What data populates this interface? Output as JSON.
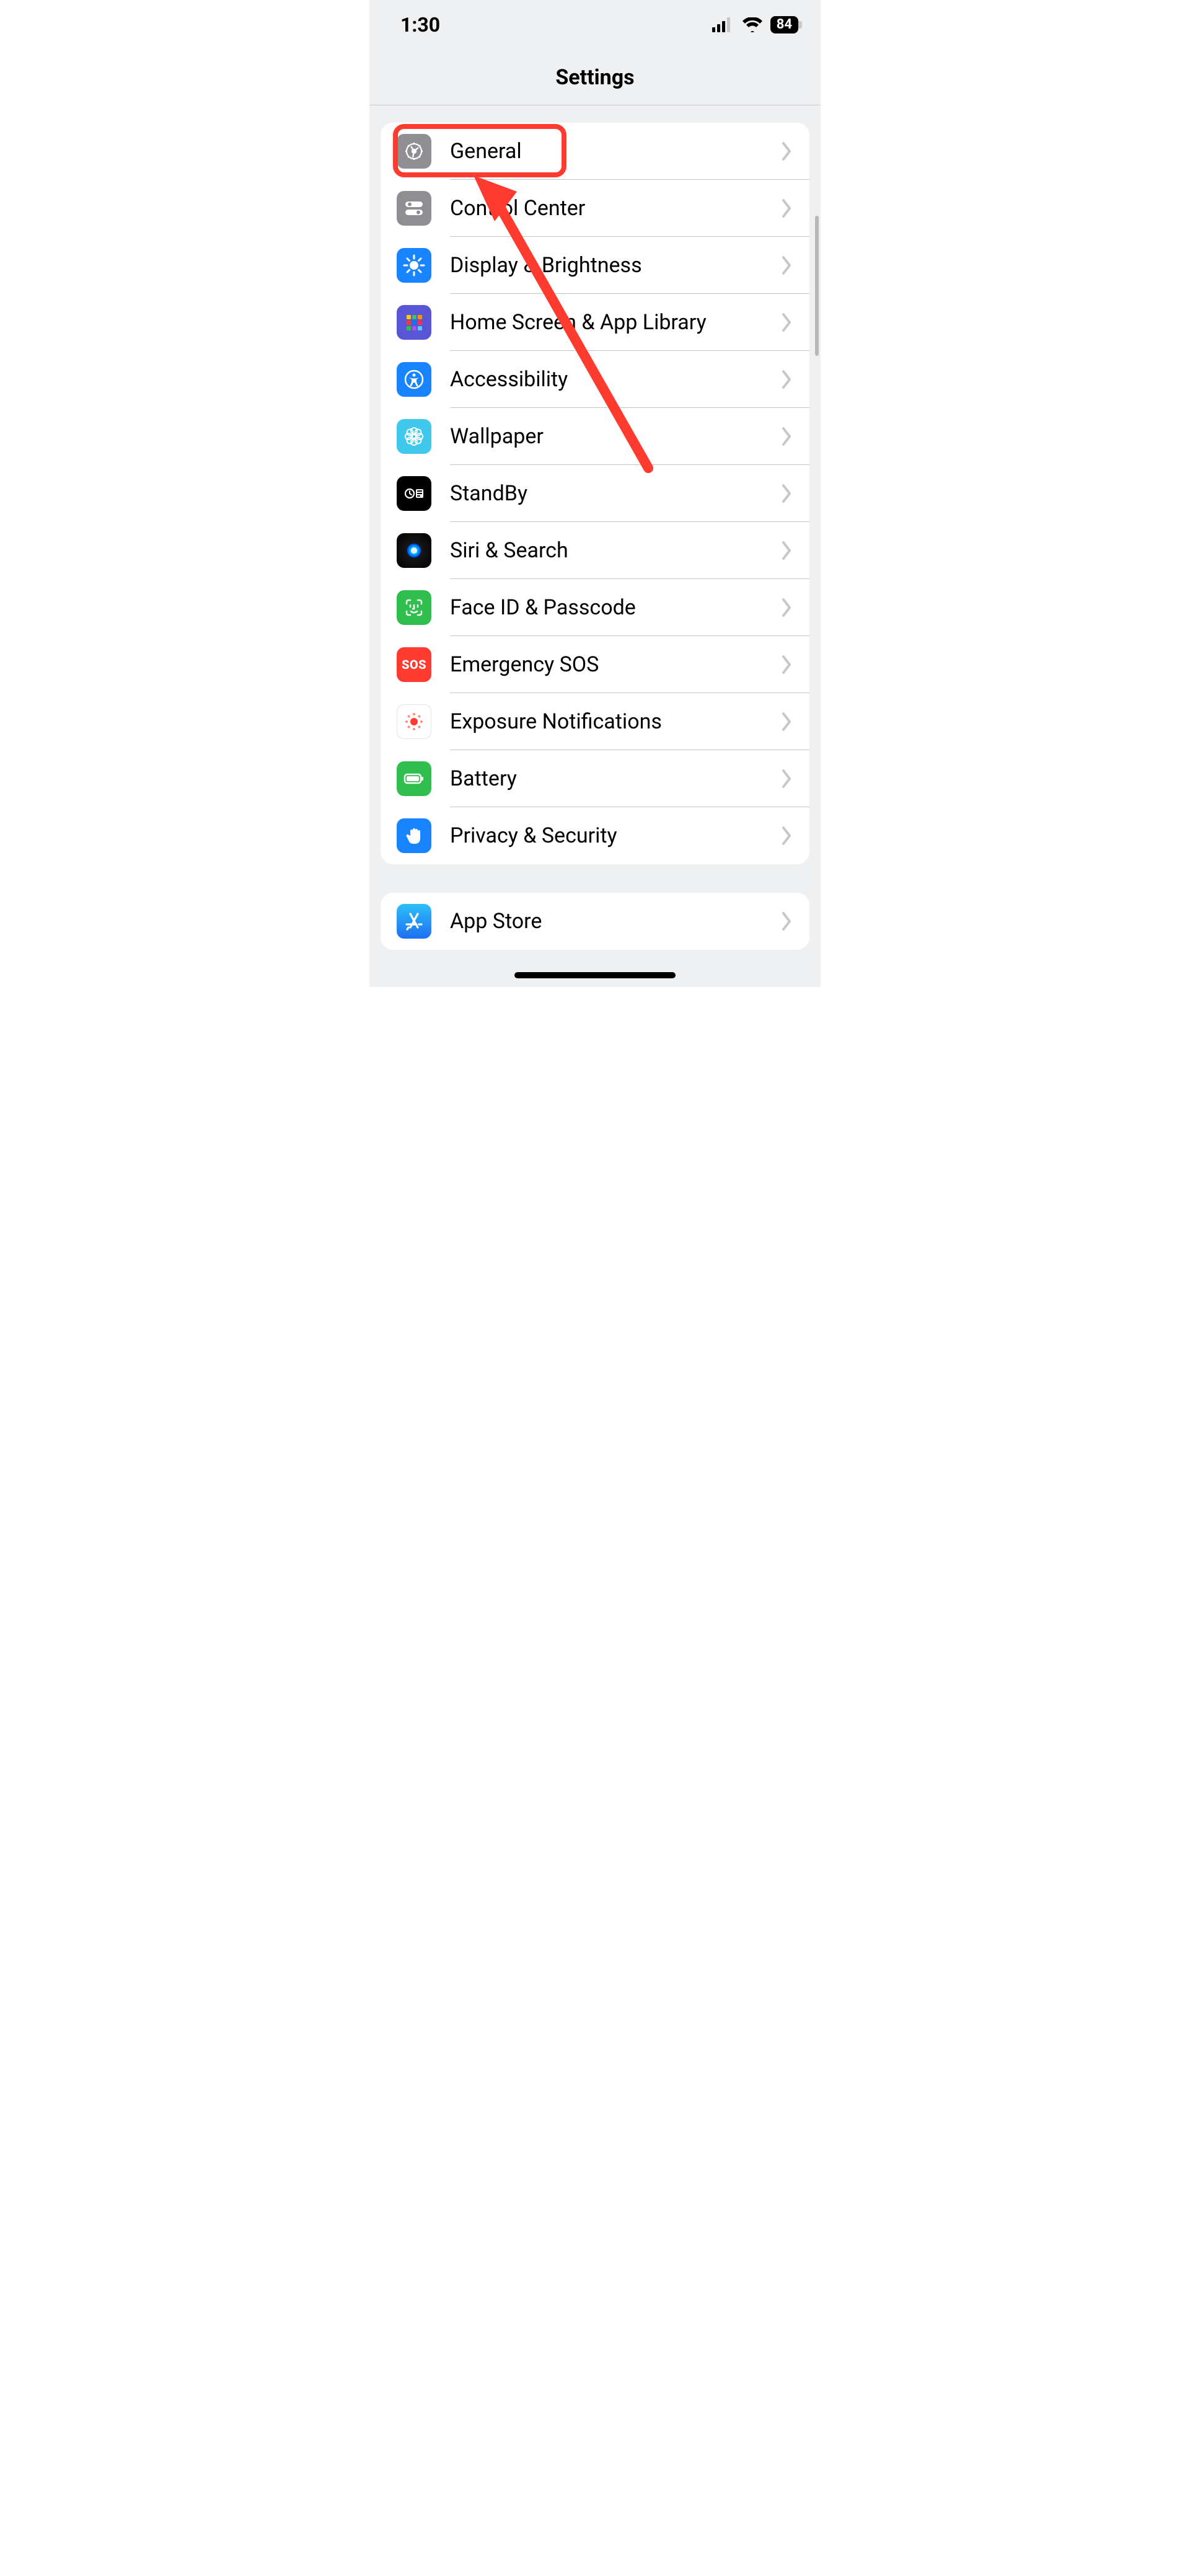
{
  "status": {
    "time": "1:30",
    "battery": "84"
  },
  "title": "Settings",
  "groups": [
    {
      "rows": [
        {
          "id": "general",
          "label": "General",
          "icon": "gear",
          "icon_bg": "#8e8e93",
          "highlighted": true
        },
        {
          "id": "control-center",
          "label": "Control Center",
          "icon": "toggles",
          "icon_bg": "#8e8e93"
        },
        {
          "id": "display",
          "label": "Display & Brightness",
          "icon": "sun",
          "icon_bg": "#1984ff"
        },
        {
          "id": "home-screen",
          "label": "Home Screen & App Library",
          "icon": "grid",
          "icon_bg": "#5856d6"
        },
        {
          "id": "accessibility",
          "label": "Accessibility",
          "icon": "person-circle",
          "icon_bg": "#1984ff"
        },
        {
          "id": "wallpaper",
          "label": "Wallpaper",
          "icon": "flower",
          "icon_bg": "#3fc8ee"
        },
        {
          "id": "standby",
          "label": "StandBy",
          "icon": "clock-card",
          "icon_bg": "#000000"
        },
        {
          "id": "siri",
          "label": "Siri & Search",
          "icon": "siri",
          "icon_bg": "#000000"
        },
        {
          "id": "faceid",
          "label": "Face ID & Passcode",
          "icon": "faceid",
          "icon_bg": "#30bf4f"
        },
        {
          "id": "sos",
          "label": "Emergency SOS",
          "icon": "sos",
          "icon_bg": "#ff3b30"
        },
        {
          "id": "exposure",
          "label": "Exposure Notifications",
          "icon": "exposure",
          "icon_bg": "#ffffff"
        },
        {
          "id": "battery",
          "label": "Battery",
          "icon": "battery",
          "icon_bg": "#30bf4f"
        },
        {
          "id": "privacy",
          "label": "Privacy & Security",
          "icon": "hand",
          "icon_bg": "#1984ff"
        }
      ]
    },
    {
      "rows": [
        {
          "id": "app-store",
          "label": "App Store",
          "icon": "appstore",
          "icon_bg": "#1e9cf0"
        }
      ]
    }
  ],
  "annotation": {
    "highlight_row": "general",
    "arrow_color": "#ff3b30"
  }
}
